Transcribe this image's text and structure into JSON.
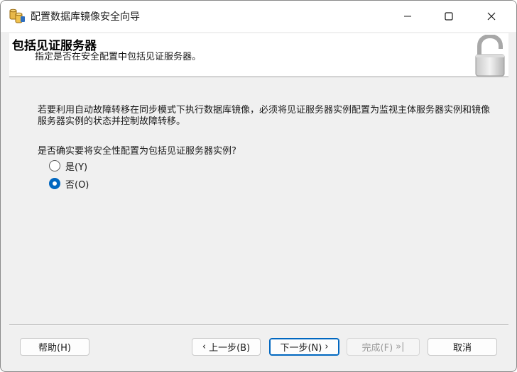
{
  "window": {
    "title": "配置数据库镜像安全向导"
  },
  "header": {
    "heading": "包括见证服务器",
    "subheading": "指定是否在安全配置中包括见证服务器。"
  },
  "body": {
    "description": "若要利用自动故障转移在同步模式下执行数据库镜像，必须将见证服务器实例配置为监视主体服务器实例和镜像服务器实例的状态并控制故障转移。",
    "question": "是否确实要将安全性配置为包括见证服务器实例?",
    "options": [
      {
        "label": "是(Y)",
        "selected": false
      },
      {
        "label": "否(O)",
        "selected": true
      }
    ]
  },
  "buttons": {
    "help": "帮助(H)",
    "back": "上一步(B)",
    "back_glyph": "‹",
    "next": "下一步(N)",
    "next_glyph": "›",
    "finish": "完成(F)",
    "finish_glyph": "»|",
    "cancel": "取消"
  },
  "colors": {
    "accent": "#0067c0",
    "window_bg": "#f0f0f0",
    "banner_bg": "#ffffff",
    "disabled_text": "#9a9a9a"
  },
  "icons": {
    "app": "database-mirroring-icon",
    "header": "open-padlock-icon"
  }
}
